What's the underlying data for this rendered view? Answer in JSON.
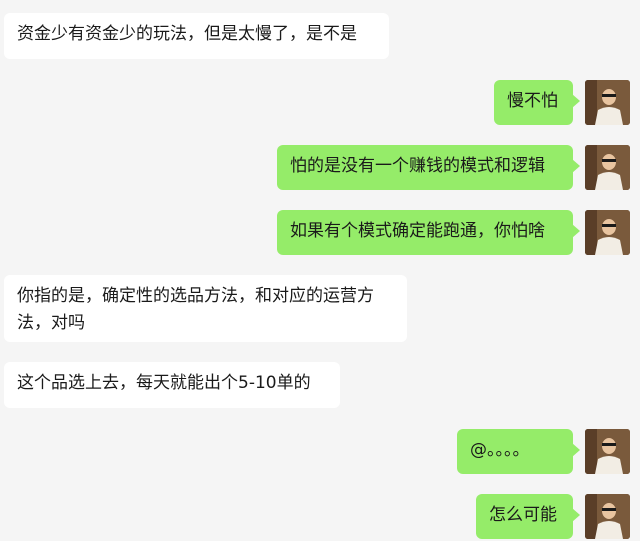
{
  "colors": {
    "background": "#f5f5f5",
    "incoming_bubble": "#ffffff",
    "outgoing_bubble": "#95ec69",
    "text": "#1a1a1a"
  },
  "messages": [
    {
      "side": "incoming",
      "text": "资金少有资金少的玩法，但是太慢了，是不是"
    },
    {
      "side": "outgoing",
      "text": "慢不怕"
    },
    {
      "side": "outgoing",
      "text": "怕的是没有一个赚钱的模式和逻辑"
    },
    {
      "side": "outgoing",
      "text": "如果有个模式确定能跑通，你怕啥"
    },
    {
      "side": "incoming",
      "text": "你指的是，确定性的选品方法，和对应的运营方法，对吗"
    },
    {
      "side": "incoming",
      "text": "这个品选上去，每天就能出个5-10单的"
    },
    {
      "side": "outgoing",
      "text": "@。。。。"
    },
    {
      "side": "outgoing",
      "text": "怎么可能"
    }
  ],
  "avatar_icon": "user-avatar-photo"
}
